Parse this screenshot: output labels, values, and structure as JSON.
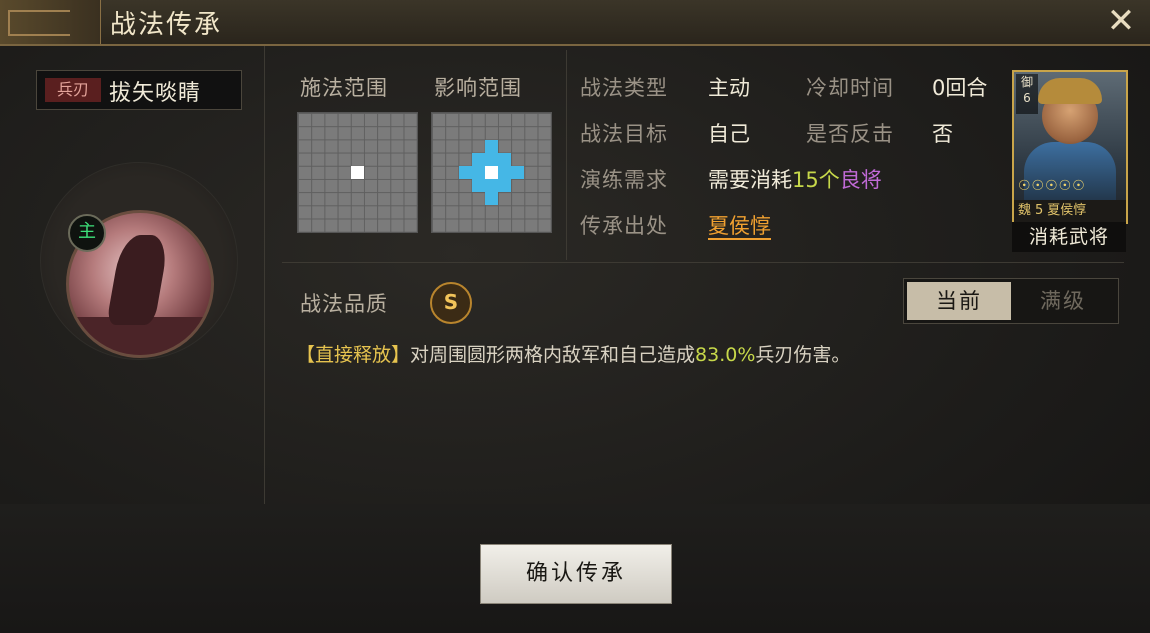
{
  "window": {
    "title": "战法传承",
    "close_icon": "✕"
  },
  "skill": {
    "type_tag": "兵刃",
    "name": "拔矢啖睛",
    "main_badge": "主",
    "quality_label": "战法品质",
    "quality_value": "S"
  },
  "ranges": {
    "cast_label": "施法范围",
    "effect_label": "影响范围",
    "grid_size": 9
  },
  "info": {
    "type_label": "战法类型",
    "type_value": "主动",
    "cooldown_label": "冷却时间",
    "cooldown_value": "0回合",
    "target_label": "战法目标",
    "target_value": "自己",
    "counter_label": "是否反击",
    "counter_value": "否",
    "practice_label": "演练需求",
    "practice_prefix": "需要消耗",
    "practice_count": "15个",
    "practice_item": "良将",
    "source_label": "传承出处",
    "source_value": "夏侯惇"
  },
  "general_card": {
    "badge": "御",
    "badge_num": "6",
    "stars": "☉☉☉☉☉",
    "faction": "魏",
    "cost": "5",
    "name": "夏侯惇",
    "consume_label": "消耗武将"
  },
  "toggle": {
    "current": "当前",
    "max": "满级"
  },
  "description": {
    "tag": "【直接释放】",
    "text_before": "对周围圆形两格内敌军和自己造成",
    "percent": "83.0%",
    "text_after": "兵刃伤害。"
  },
  "confirm_button": "确认传承"
}
